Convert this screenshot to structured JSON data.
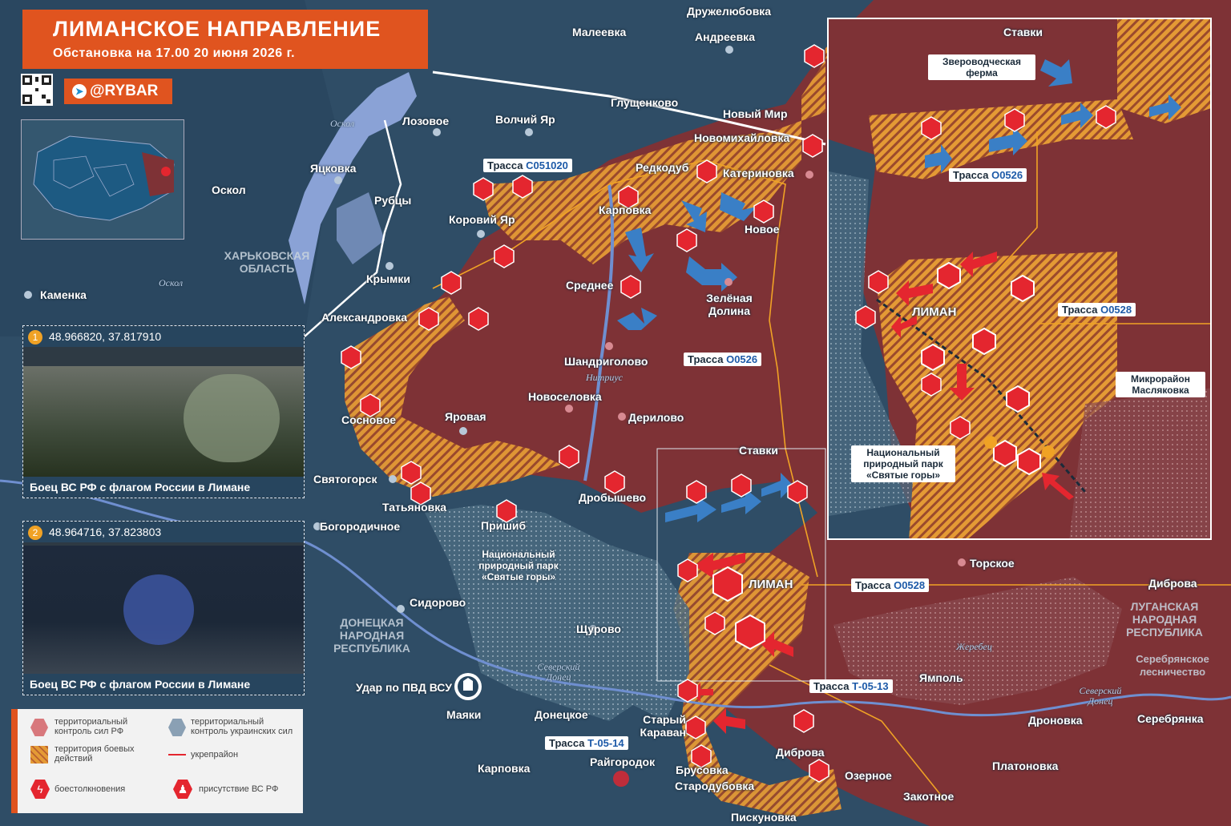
{
  "header": {
    "title": "ЛИМАНСКОЕ НАПРАВЛЕНИЕ",
    "subtitle": "Обстановка на 17.00 20 июня 2026 г.",
    "brand": "@RYBAR"
  },
  "colors": {
    "ru_control": "#7e3236",
    "ua_control": "#2f4d66",
    "combat_zone": "#e49a35",
    "accent": "#e0541f",
    "road": "#f0a225",
    "attack_red": "#e4262f",
    "attack_blue": "#3a7fc6"
  },
  "settlements": {
    "druzhelyubovka": "Дружелюбовка",
    "maleevka": "Малеевка",
    "andreevka": "Андреевка",
    "glushchenkovo": "Глущенково",
    "lozovoe": "Лозовое",
    "volchiy_yar": "Волчий Яр",
    "novy_mir": "Новый Мир",
    "novomikhaylovka": "Новомихайловка",
    "yatskovka": "Яцковка",
    "oskol": "Оскол",
    "redkodub": "Редкодуб",
    "katerinovka": "Катериновка",
    "rubtsy": "Рубцы",
    "karpovka": "Карповка",
    "novoe": "Новое",
    "koroviy_yar": "Коровий Яр",
    "krymki": "Крымки",
    "srednee": "Среднее",
    "zelenaya_dolina": "Зелёная Долина",
    "kamenka": "Каменка",
    "aleksandrovka": "Александровка",
    "shandrigolovo": "Шандриголово",
    "novoselovka": "Новоселовка",
    "derilovo": "Дерилово",
    "sosnovoe": "Сосновое",
    "yarovaya": "Яровая",
    "stavki": "Ставки",
    "svyatogorsk": "Святогорск",
    "tatyanovka": "Татьяновка",
    "drobyshevo": "Дробышево",
    "prishib": "Пришиб",
    "bogorodichnoe": "Богородичное",
    "liman": "ЛИМАН",
    "torskoe": "Торское",
    "dibrova": "Диброва",
    "sidorovo": "Сидорово",
    "shchurovo": "Щурово",
    "yampol": "Ямполь",
    "mayaki": "Маяки",
    "donetskoe": "Донецкое",
    "stary_karavan": "Старый Караван",
    "droznovka": "Дроновка",
    "serebryanka": "Серебрянка",
    "raygorodok": "Райгородок",
    "dibrova2": "Диброва",
    "karpovka2": "Карповка",
    "brusovka": "Брусовка",
    "starodubovka": "Стародубовка",
    "ozernoe": "Озерное",
    "platonovka": "Платоновка",
    "zakotnoe": "Закотное",
    "piskunovka": "Пискуновка"
  },
  "regions": {
    "kharkov": "ХАРЬКОВСКАЯ ОБЛАСТЬ",
    "donetsk": "ДОНЕЦКАЯ НАРОДНАЯ РЕСПУБЛИКА",
    "lugansk": "ЛУГАНСКАЯ НАРОДНАЯ РЕСПУБЛИКА",
    "forest": "Серебрянское лесничество",
    "park": "Национальный природный парк «Святые горы»"
  },
  "rivers": {
    "oskol1": "Оскол",
    "oskol2": "Оскол",
    "seversky1": "Северский Донец",
    "seversky2": "Северский Донец",
    "nitrius": "Нитриус",
    "zherebets": "Жеребец"
  },
  "roads": {
    "r1": {
      "prefix": "Трасса",
      "code": "С051020"
    },
    "r2": {
      "prefix": "Трасса",
      "code": "О0526"
    },
    "r3": {
      "prefix": "Трасса",
      "code": "О0528"
    },
    "r4": {
      "prefix": "Трасса",
      "code": "Т-05-13"
    },
    "r5": {
      "prefix": "Трасса",
      "code": "Т-05-14"
    }
  },
  "strike": "Удар по ПВД ВСУ",
  "inset": {
    "stavki": "Ставки",
    "farm": "Звероводческая ферма",
    "road1_prefix": "Трасса",
    "road1_code": "О0526",
    "road2_prefix": "Трасса",
    "road2_code": "О0528",
    "liman": "ЛИМАН",
    "district": "Микрорайон Масляковка",
    "park": "Национальный природный парк «Святые горы»"
  },
  "videos": [
    {
      "num": "1",
      "coords": "48.966820, 37.817910",
      "caption": "Боец ВС РФ с флагом России в Лимане"
    },
    {
      "num": "2",
      "coords": "48.964716, 37.823803",
      "caption": "Боец ВС РФ с флагом России в Лимане"
    }
  ],
  "legend": {
    "ru": "территориальный контроль сил РФ",
    "ua": "территориальный контроль украинских сил",
    "combat": "территория боевых действий",
    "fort": "укрепрайон",
    "clash": "боестолкновения",
    "presence": "присутствие ВС РФ"
  },
  "icons": {
    "telegram": "telegram-icon",
    "clash": "explosion-icon",
    "soldier": "soldier-icon",
    "flag": "flag-icon",
    "strike": "airstrike-icon"
  }
}
